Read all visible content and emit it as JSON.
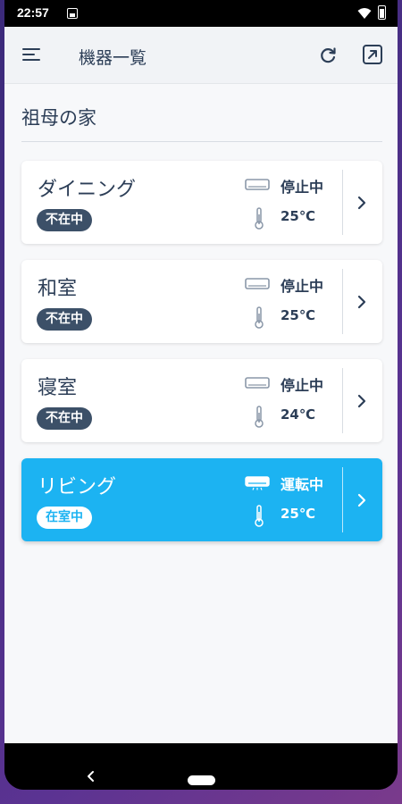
{
  "statusbar": {
    "time": "22:57"
  },
  "appbar": {
    "title": "機器一覧"
  },
  "location": {
    "title": "祖母の家"
  },
  "devices": [
    {
      "name": "ダイニング",
      "presence": "不在中",
      "status": "停止中",
      "temperature": "25℃",
      "active": false
    },
    {
      "name": "和室",
      "presence": "不在中",
      "status": "停止中",
      "temperature": "25℃",
      "active": false
    },
    {
      "name": "寝室",
      "presence": "不在中",
      "status": "停止中",
      "temperature": "24℃",
      "active": false
    },
    {
      "name": "リビング",
      "presence": "在室中",
      "status": "運転中",
      "temperature": "25℃",
      "active": true
    }
  ],
  "colors": {
    "accent": "#1cb3f2",
    "text": "#2c3e57",
    "badge": "#3c5068"
  },
  "icons": [
    "menu-icon",
    "refresh-icon",
    "exit-icon",
    "air-conditioner-icon",
    "thermometer-icon",
    "chevron-right-icon",
    "back-icon",
    "home-pill"
  ]
}
